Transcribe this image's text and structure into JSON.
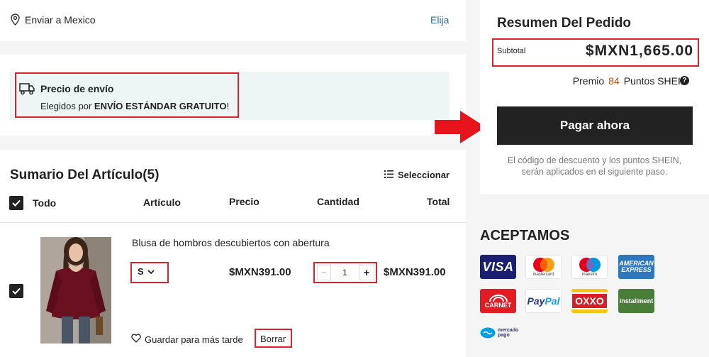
{
  "shipping": {
    "location": "Enviar a Mexico",
    "change_link": "Elija",
    "title": "Precio de envío",
    "desc_prefix": "Elegidos por",
    "desc_bold": "ENVÍO ESTÁNDAR GRATUITO",
    "desc_suffix": "!"
  },
  "items_section": {
    "title": "Sumario Del Artículo(5)",
    "select_label": "Seleccionar",
    "columns": {
      "all": "Todo",
      "article": "Artículo",
      "price": "Precio",
      "quantity": "Cantidad",
      "total": "Total"
    }
  },
  "item": {
    "name": "Blusa de hombros descubiertos con abertura",
    "size": "S",
    "price": "$MXN391.00",
    "quantity": "1",
    "minus": "−",
    "plus": "+",
    "total": "$MXN391.00",
    "save_later": "Guardar para más tarde",
    "delete": "Borrar"
  },
  "summary": {
    "title": "Resumen Del Pedido",
    "subtotal_label": "Subtotal",
    "subtotal_value": "$MXN1,665.00",
    "points_prefix": "Premio",
    "points_value": "84",
    "points_suffix": "Puntos SHEIN",
    "help": "?",
    "pay_button": "Pagar ahora",
    "note_line1": "El código de descuento y los puntos SHEIN,",
    "note_line2": "serán aplicados en el siguiente paso."
  },
  "accept": {
    "title": "ACEPTAMOS",
    "logos": {
      "visa": "VISA",
      "mastercard": "mastercard",
      "maestro": "maestro",
      "amex_1": "AMERICAN",
      "amex_2": "EXPRESS",
      "carnet": "CARNET",
      "paypal_1": "Pay",
      "paypal_2": "Pal",
      "oxxo": "OXXO",
      "installment": "installment",
      "mercado_1": "mercado",
      "mercado_2": "pago"
    }
  },
  "colors": {
    "accent_red": "#d9232e",
    "points_orange": "#c44a0c",
    "link_blue": "#2d68a8",
    "button_black": "#222222"
  }
}
